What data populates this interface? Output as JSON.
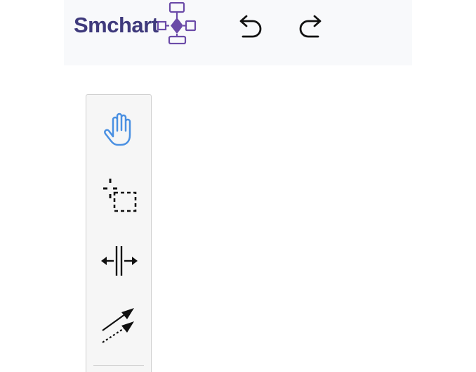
{
  "app": {
    "brand_name": "Smchart",
    "brand_color": "#3f3a7c",
    "brand_accent": "#6b4ba8"
  },
  "toolbar": {
    "undo_icon": "undo-icon",
    "redo_icon": "redo-icon"
  },
  "palette": {
    "tools": [
      {
        "icon": "hand-icon",
        "active": true,
        "accent": "#4a90e2"
      },
      {
        "icon": "lasso-icon",
        "active": false
      },
      {
        "icon": "space-tool-icon",
        "active": false
      },
      {
        "icon": "global-connect-icon",
        "active": false
      }
    ]
  }
}
